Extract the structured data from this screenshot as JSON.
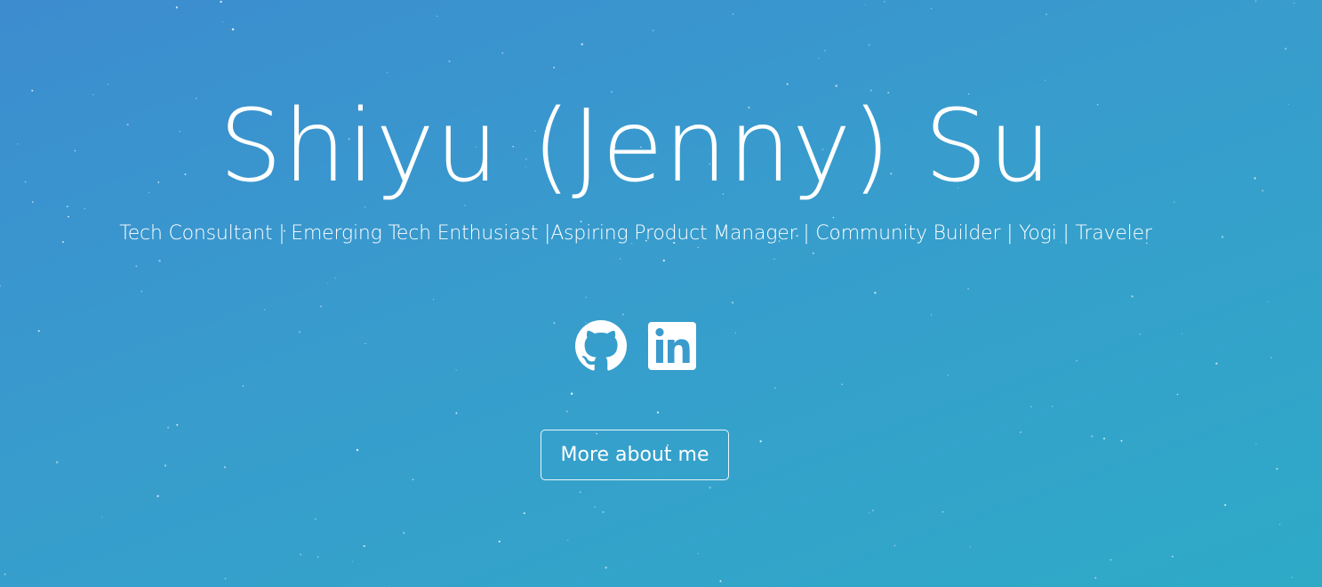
{
  "hero": {
    "name": "Shiyu (Jenny) Su",
    "tagline": "Tech Consultant | Emerging Tech Enthusiast |Aspiring Product Manager | Community Builder | Yogi | Traveler",
    "social": [
      {
        "icon": "github-icon"
      },
      {
        "icon": "linkedin-icon"
      }
    ],
    "cta_label": "More about me"
  },
  "colors": {
    "gradient_start": "#3c8ccf",
    "gradient_end": "#2eaac7",
    "text": "#ffffff"
  }
}
